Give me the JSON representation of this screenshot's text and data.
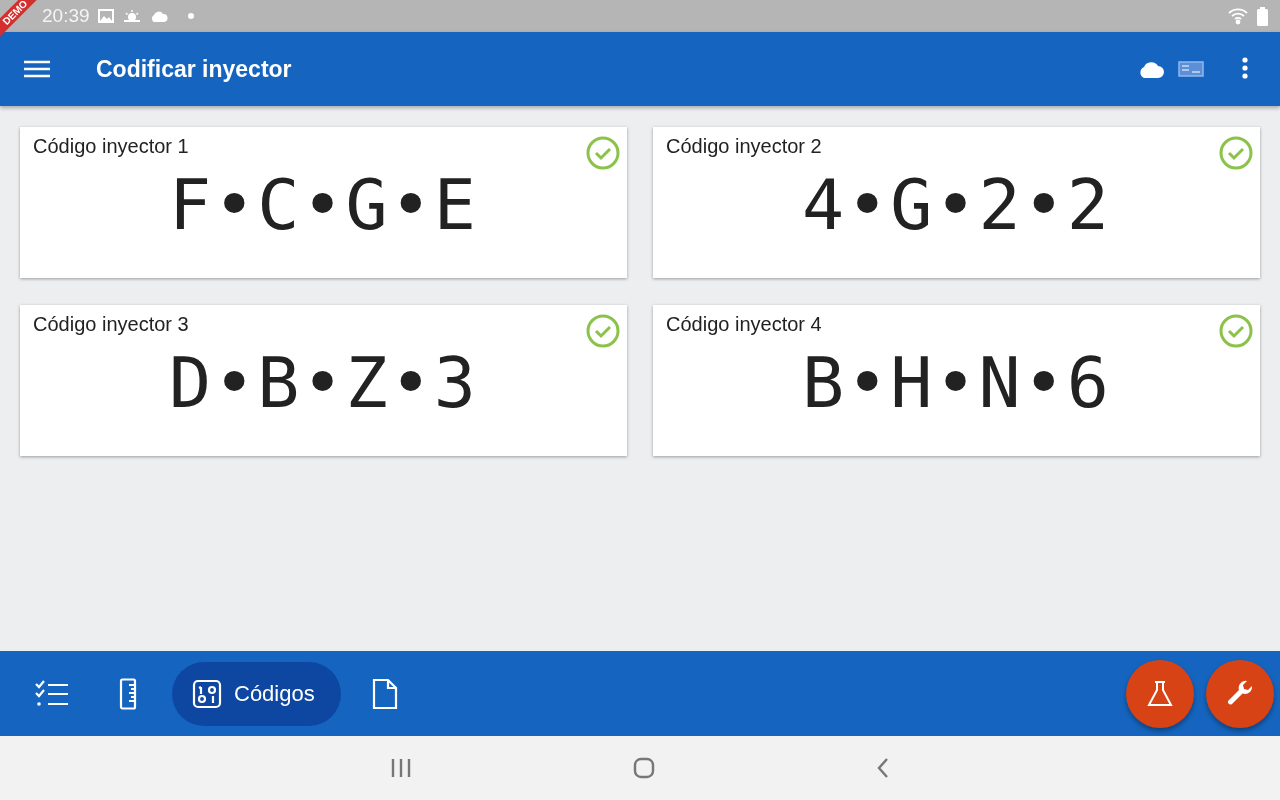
{
  "status_bar": {
    "time": "20:39"
  },
  "debug_banner": {
    "label": "DEMO"
  },
  "app_bar": {
    "title": "Codificar inyector"
  },
  "cards": [
    {
      "title": "Código inyector 1",
      "code": "F•C•G•E",
      "valid": true
    },
    {
      "title": "Código inyector 2",
      "code": "4•G•2•2",
      "valid": true
    },
    {
      "title": "Código inyector 3",
      "code": "D•B•Z•3",
      "valid": true
    },
    {
      "title": "Código inyector 4",
      "code": "B•H•N•6",
      "valid": true
    }
  ],
  "bottom_nav": [
    {
      "kind": "checklist",
      "selected": false
    },
    {
      "kind": "ruler",
      "selected": false
    },
    {
      "kind": "binary",
      "selected": true,
      "label": "Códigos"
    },
    {
      "kind": "document",
      "selected": false
    }
  ],
  "fabs": [
    {
      "kind": "flask"
    },
    {
      "kind": "wrench"
    }
  ]
}
